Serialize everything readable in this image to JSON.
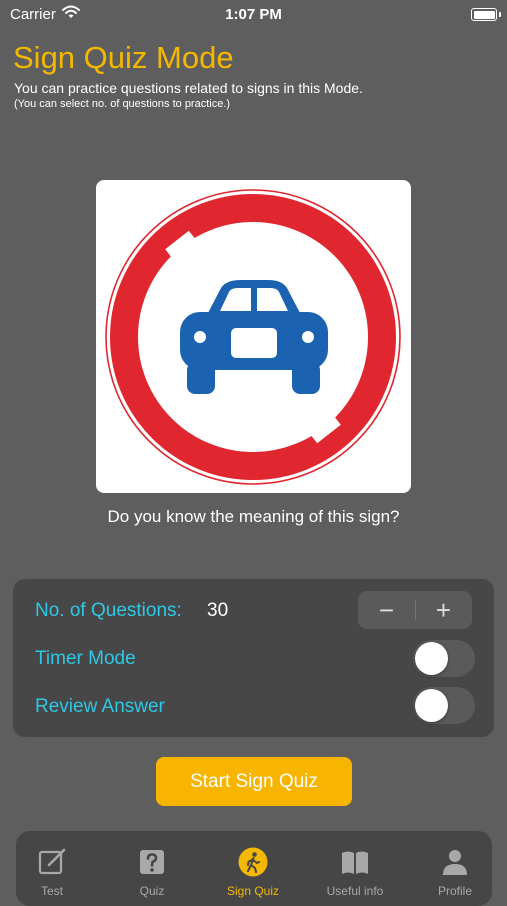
{
  "status_bar": {
    "carrier": "Carrier",
    "time": "1:07 PM"
  },
  "header": {
    "title": "Sign Quiz Mode",
    "subtitle": "You can practice questions related to signs in this Mode.",
    "note": "(You can select no. of questions to practice.)"
  },
  "sign": {
    "icon": "no-vehicles-sign-icon",
    "question": "Do you know the meaning of this sign?"
  },
  "settings": {
    "questions_label": "No. of Questions:",
    "questions_value": "30",
    "minus_label": "−",
    "plus_label": "+",
    "timer_label": "Timer Mode",
    "timer_on": false,
    "review_label": "Review Answer",
    "review_on": false
  },
  "start_button": "Start Sign Quiz",
  "tabs": [
    {
      "label": "Test",
      "icon": "pencil-square-icon",
      "active": false
    },
    {
      "label": "Quiz",
      "icon": "question-box-icon",
      "active": false
    },
    {
      "label": "Sign Quiz",
      "icon": "walking-person-icon",
      "active": true
    },
    {
      "label": "Useful info",
      "icon": "open-book-icon",
      "active": false
    },
    {
      "label": "Profile",
      "icon": "person-icon",
      "active": false
    }
  ],
  "colors": {
    "accent": "#f5b800",
    "label": "#2ec8e6",
    "background": "#5e5e5e",
    "panel": "#474747"
  }
}
